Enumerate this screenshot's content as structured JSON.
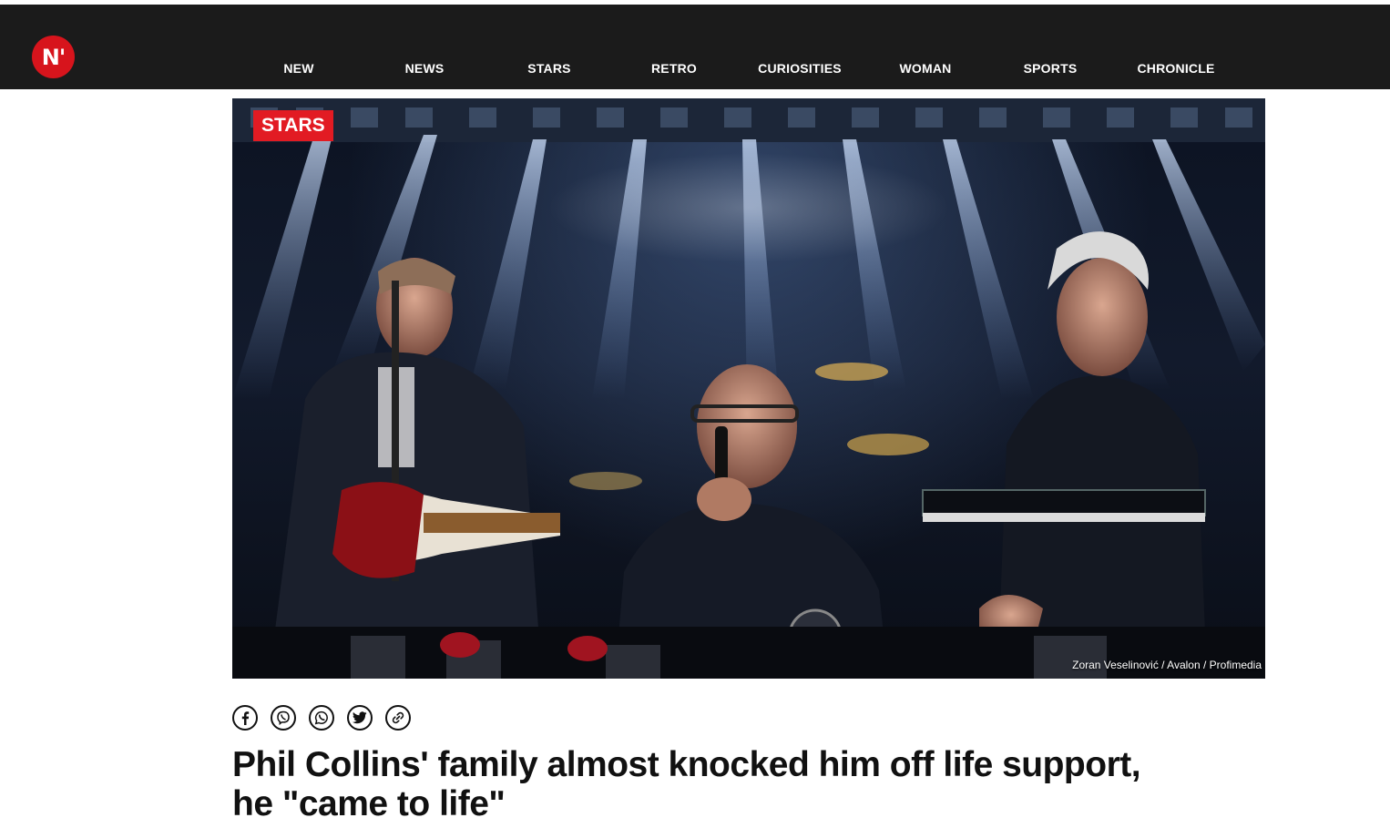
{
  "site": {
    "logo_text": "N'",
    "nav": [
      "NEW",
      "NEWS",
      "STARS",
      "RETRO",
      "CURIOSITIES",
      "WOMAN",
      "SPORTS",
      "CHRONICLE"
    ]
  },
  "article": {
    "category": "STARS",
    "photo_credit": "Zoran Veselinović / Avalon / Profimedia",
    "headline_line1": "Phil Collins' family almost knocked him off life support,",
    "headline_line2": "he \"came to life\""
  },
  "share_icons": [
    "facebook-icon",
    "viber-icon",
    "whatsapp-icon",
    "twitter-icon",
    "link-icon"
  ],
  "colors": {
    "nav_bg": "#1b1b1b",
    "brand_red": "#d7141c",
    "badge_red": "#e21b23"
  }
}
